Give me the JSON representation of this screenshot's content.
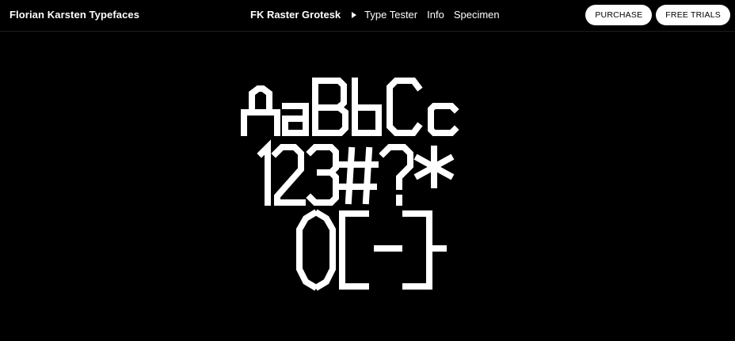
{
  "header": {
    "brand": "Florian Karsten Typefaces",
    "font_name": "FK Raster Grotesk",
    "nav": [
      "Type Tester",
      "Info",
      "Specimen"
    ],
    "purchase_label": "PURCHASE",
    "free_trials_label": "FREE TRIALS"
  },
  "specimen": {
    "line1": "AaBbCc",
    "line2": "123#?*",
    "line3": "()[]-",
    "color": "#ffffff",
    "background": "#000000"
  },
  "icons": {
    "play": "play-icon"
  }
}
